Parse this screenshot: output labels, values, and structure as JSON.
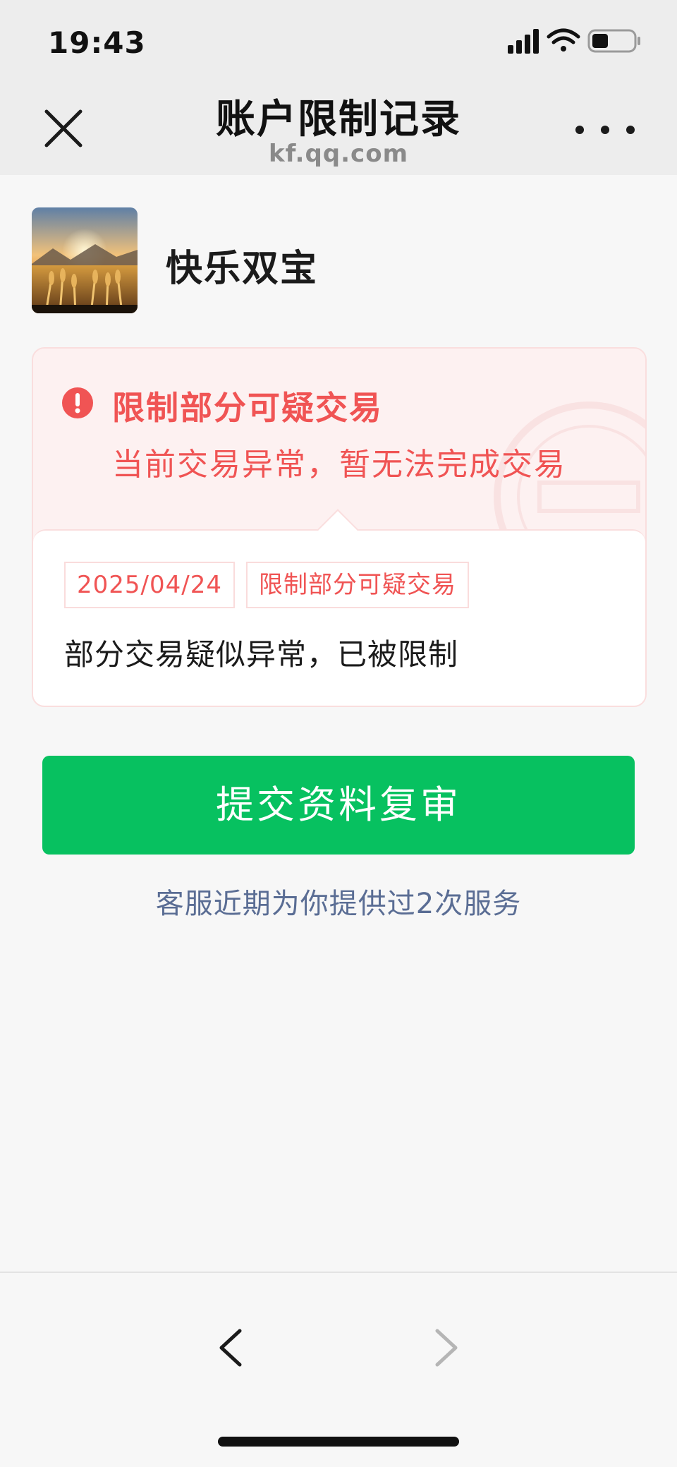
{
  "status_bar": {
    "time": "19:43"
  },
  "nav": {
    "title": "账户限制记录",
    "subtitle": "kf.qq.com",
    "close_icon": "close-icon",
    "more_icon": "more-icon"
  },
  "account": {
    "name": "快乐双宝"
  },
  "restriction": {
    "title": "限制部分可疑交易",
    "description": "当前交易异常，暂无法完成交易",
    "tags": [
      "2025/04/24",
      "限制部分可疑交易"
    ],
    "detail": "部分交易疑似异常，已被限制"
  },
  "actions": {
    "review_button": "提交资料复审",
    "service_link": "客服近期为你提供过2次服务"
  },
  "colors": {
    "accent_green": "#07c160",
    "alert_red": "#f05454",
    "link_blue": "#5a6d94"
  }
}
